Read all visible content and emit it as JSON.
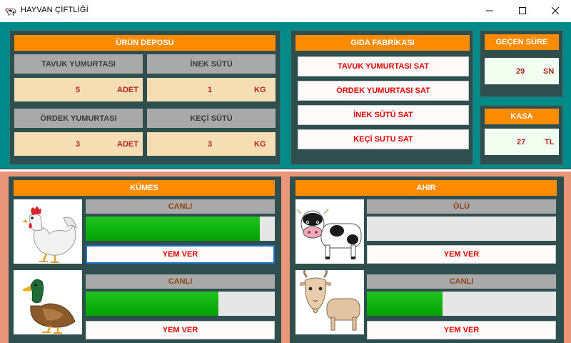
{
  "window": {
    "title": "HAYVAN ÇİFTLİĞİ",
    "controls": {
      "minimize": "—",
      "maximize": "☐",
      "close": "✕"
    }
  },
  "depot": {
    "title": "ÜRÜN DEPOSU",
    "chicken_egg": {
      "label": "TAVUK YUMURTASI",
      "value": "5",
      "unit": "ADET"
    },
    "cow_milk": {
      "label": "İNEK SÜTÜ",
      "value": "1",
      "unit": "KG"
    },
    "duck_egg": {
      "label": "ÖRDEK YUMURTASI",
      "value": "3",
      "unit": "ADET"
    },
    "goat_milk": {
      "label": "KEÇİ SÜTÜ",
      "value": "3",
      "unit": "KG"
    }
  },
  "factory": {
    "title": "GIDA FABRİKASI",
    "buttons": [
      "TAVUK YUMURTASI SAT",
      "ÖRDEK YUMURTASI SAT",
      "İNEK SÜTÜ SAT",
      "KEÇİ SUTU SAT"
    ]
  },
  "elapsed": {
    "title": "GEÇEN SÜRE",
    "value": "29",
    "unit": "SN"
  },
  "cash": {
    "title": "KASA",
    "value": "27",
    "unit": "TL"
  },
  "coop": {
    "title": "KÜMES",
    "animals": [
      {
        "name": "chicken",
        "status": "CANLI",
        "level": 0.92,
        "feed_label": "YEM VER"
      },
      {
        "name": "duck",
        "status": "CANLI",
        "level": 0.7,
        "feed_label": "YEM VER"
      }
    ]
  },
  "barn": {
    "title": "AHIR",
    "animals": [
      {
        "name": "cow",
        "status": "ÖLÜ",
        "level": 0.0,
        "feed_label": "YEM VER"
      },
      {
        "name": "goat",
        "status": "CANLI",
        "level": 0.4,
        "feed_label": "YEM VER"
      }
    ]
  },
  "colors": {
    "teal_bg": "#008b8b",
    "panel_bg": "#2f4f4f",
    "header_orange": "#ff8c00",
    "bottom_bg": "#e9967a",
    "value_red": "#b22222",
    "sell_red": "#e00000",
    "progress_green": "#0fb40f"
  }
}
